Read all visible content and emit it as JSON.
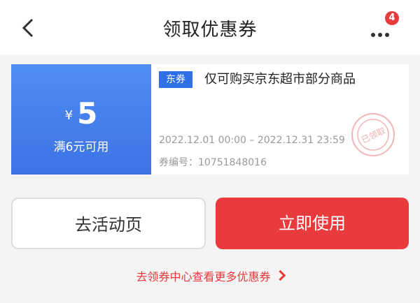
{
  "header": {
    "title": "领取优惠券",
    "badge_count": "4"
  },
  "coupon": {
    "currency": "¥",
    "amount": "5",
    "condition": "满6元可用",
    "tag": "东券",
    "description": "仅可购买京东超市部分商品",
    "validity": "2022.12.01 00:00 – 2022.12.31 23:59",
    "code": "券编号：10751848016",
    "stamp_text": "已领取"
  },
  "actions": {
    "activity_label": "去活动页",
    "use_label": "立即使用"
  },
  "footer_link": {
    "label": "去领券中心查看更多优惠券"
  },
  "colors": {
    "accent": "#e93b3d",
    "coupon_blue": "#4f8ef3"
  }
}
